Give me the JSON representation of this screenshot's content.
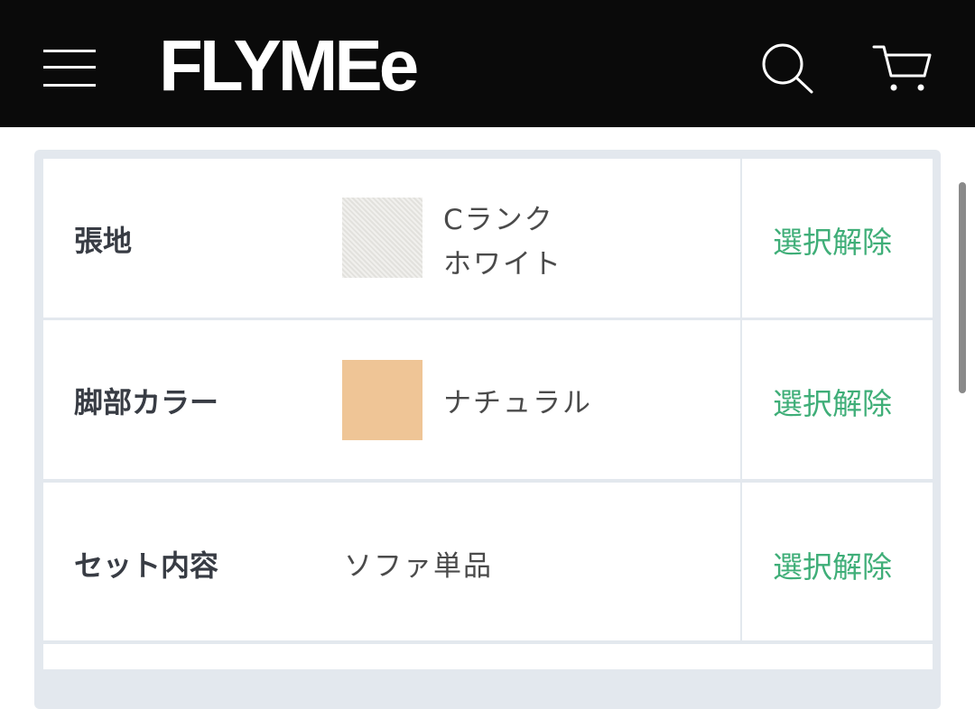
{
  "header": {
    "logo": "FLYMEe",
    "menu_icon": "hamburger-menu-icon",
    "search_icon": "search-icon",
    "cart_icon": "cart-icon"
  },
  "options": [
    {
      "label": "張地",
      "value_line1": "Cランク",
      "value_line2": "ホワイト",
      "swatch_color": "#e9e8e4",
      "action": "選択解除"
    },
    {
      "label": "脚部カラー",
      "value": "ナチュラル",
      "swatch_color": "#efc596",
      "action": "選択解除"
    },
    {
      "label": "セット内容",
      "value": "ソファ単品",
      "action": "選択解除"
    }
  ],
  "colors": {
    "header_bg": "#0a0a0a",
    "accent": "#3fae78",
    "panel_border": "#e3e8ee"
  }
}
